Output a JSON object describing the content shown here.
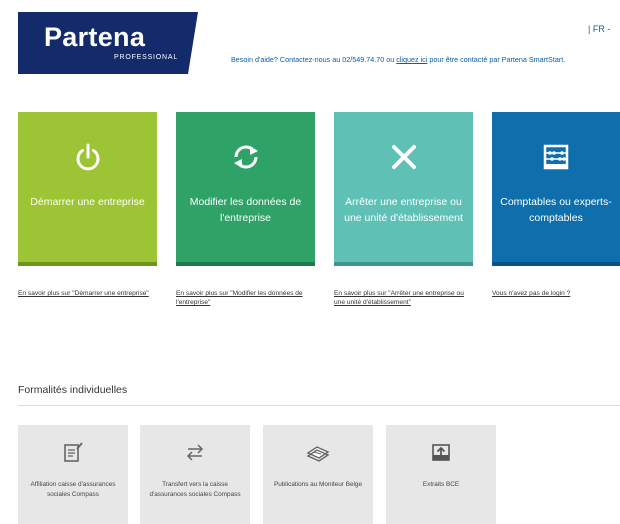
{
  "header": {
    "logo_text": "Partena",
    "logo_sub": "PROFESSIONAL",
    "lang": "| FR -",
    "help_before": "Besoin d'aide? Contactez-nous au 02/549.74.70 ou ",
    "help_link": "cliquez ici",
    "help_after": " pour être contacté par Partena SmartStart."
  },
  "tiles": [
    {
      "label": "Démarrer une entreprise",
      "icon": "power-icon",
      "color": "#9dc434"
    },
    {
      "label": "Modifier les données de l'entreprise",
      "icon": "refresh-icon",
      "color": "#2fa267"
    },
    {
      "label": "Arrêter une entreprise ou une unité d'établissement",
      "icon": "close-icon",
      "color": "#5fc0b6"
    },
    {
      "label": "Comptables ou experts-comptables",
      "icon": "abacus-icon",
      "color": "#0f6fad"
    }
  ],
  "links": [
    "En savoir plus sur \"Démarrer une entreprise\"",
    "En savoir plus sur \"Modifier les données de l'entreprise\"",
    "En savoir plus sur \"Arrêter une entreprise ou une unité d'établissement\"",
    "Vous n'avez pas de login ?"
  ],
  "section": {
    "title": "Formalités individuelles",
    "items": [
      {
        "label": "Affiliation caisse d'assurances sociales Compass",
        "icon": "document-icon"
      },
      {
        "label": "Transfert vers la caisse d'assurances sociales Compass",
        "icon": "transfer-icon"
      },
      {
        "label": "Publications au Moniteur Belge",
        "icon": "papers-icon"
      },
      {
        "label": "Extraits BCE",
        "icon": "inbox-upload-icon"
      }
    ]
  }
}
